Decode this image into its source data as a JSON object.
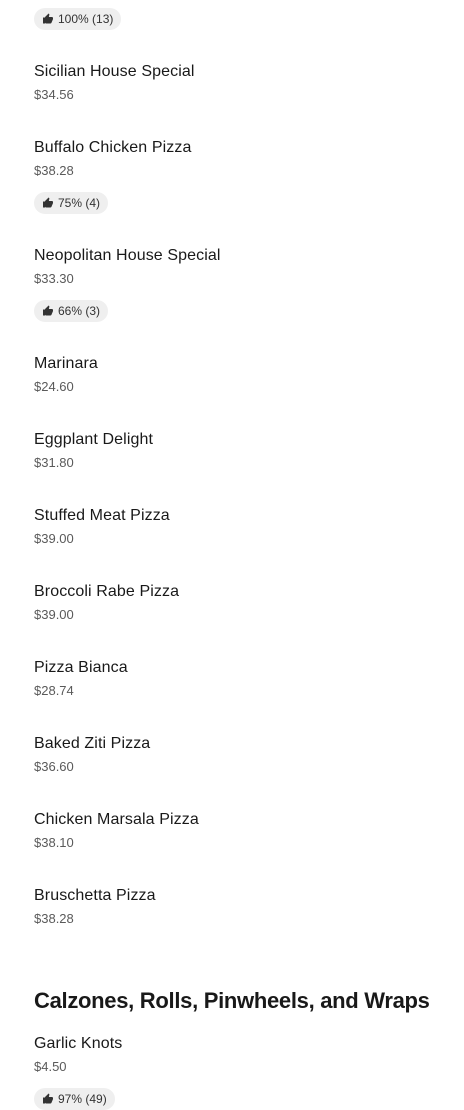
{
  "menu": {
    "top_rating": {
      "icon": "thumbs-up-icon",
      "text": "100% (13)"
    },
    "items": [
      {
        "name": "Sicilian House Special",
        "price": "$34.56"
      },
      {
        "name": "Buffalo Chicken Pizza",
        "price": "$38.28",
        "rating": "75% (4)"
      },
      {
        "name": "Neopolitan House Special",
        "price": "$33.30",
        "rating": "66% (3)"
      },
      {
        "name": "Marinara",
        "price": "$24.60"
      },
      {
        "name": "Eggplant Delight",
        "price": "$31.80"
      },
      {
        "name": "Stuffed Meat Pizza",
        "price": "$39.00"
      },
      {
        "name": "Broccoli Rabe Pizza",
        "price": "$39.00"
      },
      {
        "name": "Pizza Bianca",
        "price": "$28.74"
      },
      {
        "name": "Baked Ziti Pizza",
        "price": "$36.60"
      },
      {
        "name": "Chicken Marsala Pizza",
        "price": "$38.10"
      },
      {
        "name": "Bruschetta Pizza",
        "price": "$38.28"
      }
    ],
    "section2": {
      "title": "Calzones, Rolls, Pinwheels, and Wraps",
      "items": [
        {
          "name": "Garlic Knots",
          "price": "$4.50",
          "rating": "97% (49)"
        }
      ]
    }
  },
  "colors": {
    "text": "#191919",
    "price": "#5a5a5a",
    "rating_bg": "#efefef"
  }
}
